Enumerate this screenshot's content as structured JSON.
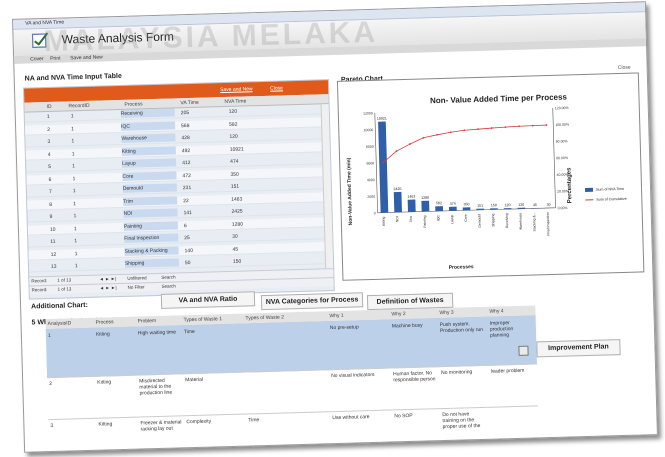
{
  "window": {
    "title": "VA and NVA Time"
  },
  "form": {
    "title": "Waste Analysis Form"
  },
  "ribbon": {
    "items": [
      "Cover",
      "Print",
      "Save and New"
    ]
  },
  "watermark": "MALAYSIA MELAKA",
  "nva": {
    "section_title": "NA and NVA Time Input Table",
    "save_new_label": "Save and New",
    "close_label": "Close",
    "columns": [
      "ID",
      "RecordID",
      "Process",
      "VA Time",
      "NVA Time"
    ],
    "rows": [
      {
        "id": "1",
        "rid": "1",
        "process": "Receiving",
        "va": "205",
        "nva": "120"
      },
      {
        "id": "2",
        "rid": "1",
        "process": "IQC",
        "va": "568",
        "nva": "582"
      },
      {
        "id": "3",
        "rid": "1",
        "process": "Warehouse",
        "va": "428",
        "nva": "120"
      },
      {
        "id": "4",
        "rid": "1",
        "process": "Kitting",
        "va": "492",
        "nva": "10921"
      },
      {
        "id": "5",
        "rid": "1",
        "process": "Layup",
        "va": "412",
        "nva": "474"
      },
      {
        "id": "6",
        "rid": "1",
        "process": "Core",
        "va": "472",
        "nva": "350"
      },
      {
        "id": "7",
        "rid": "1",
        "process": "Demould",
        "va": "231",
        "nva": "151"
      },
      {
        "id": "8",
        "rid": "1",
        "process": "Trim",
        "va": "22",
        "nva": "1463"
      },
      {
        "id": "9",
        "rid": "1",
        "process": "NDI",
        "va": "141",
        "nva": "2425"
      },
      {
        "id": "10",
        "rid": "1",
        "process": "Painting",
        "va": "6",
        "nva": "1280"
      },
      {
        "id": "11",
        "rid": "1",
        "process": "Final Inspection",
        "va": "25",
        "nva": "30"
      },
      {
        "id": "12",
        "rid": "1",
        "process": "Stacking & Packing",
        "va": "140",
        "nva": "45"
      },
      {
        "id": "13",
        "rid": "1",
        "process": "Shipping",
        "va": "50",
        "nva": "150"
      }
    ],
    "nav1": {
      "record_label": "Record:",
      "position": "1 of 13",
      "filter": "Unfiltered",
      "search": "Search"
    },
    "nav2": {
      "record_label": "Record:",
      "position": "1 of 13",
      "filter": "No Filter",
      "search": "Search"
    }
  },
  "pareto": {
    "section_title": "Pareto Chart",
    "close_label": "Close"
  },
  "chart_data": {
    "type": "bar",
    "title": "Non- Value Added Time per Process",
    "ylabel": "Non-Value Added Time (min)",
    "y2label": "Percentages",
    "xlabel": "Processes",
    "ylim": [
      0,
      12000
    ],
    "yticks": [
      "12000",
      "10000",
      "8000",
      "6000",
      "4000",
      "2000",
      "0"
    ],
    "y2ticks": [
      "120.00%",
      "100.00%",
      "80.00%",
      "60.00%",
      "40.00%",
      "20.00%",
      "0.00%"
    ],
    "categories": [
      "Kitting",
      "NDI",
      "Trim",
      "Painting",
      "IQC",
      "Layup",
      "Core",
      "Demould",
      "Shipping",
      "Receiving",
      "Warehouse",
      "Stacking &...",
      "Final Inspection"
    ],
    "series": [
      {
        "name": "Sum of NVA Time",
        "values": [
          10921,
          2425,
          1463,
          1280,
          582,
          474,
          350,
          151,
          150,
          120,
          120,
          45,
          30
        ]
      },
      {
        "name": "Sum of Cumulative",
        "values": [
          60.0,
          73.3,
          81.4,
          88.4,
          91.6,
          94.2,
          96.1,
          97.0,
          97.8,
          98.5,
          99.1,
          99.4,
          99.6
        ]
      }
    ],
    "data_labels": [
      "10921",
      "2425",
      "1463",
      "1280",
      "582",
      "474",
      "350",
      "151",
      "150",
      "120",
      "120",
      "45",
      "30"
    ],
    "legend_position": "right"
  },
  "additional": {
    "title": "Additional Chart:",
    "buttons": [
      "VA and NVA Ratio",
      "NVA Categories for Process",
      "Definition of Wastes"
    ]
  },
  "whys": {
    "title": "5 Whys Analysis Table",
    "columns": [
      "AnalysisID",
      "Process",
      "Problem",
      "Types of Waste 1",
      "Types of Waste 2",
      "Why 1",
      "Why 2",
      "Why 3",
      "Why 4"
    ],
    "rows": [
      {
        "id": "1",
        "process": "Kitting",
        "problem": "High waiting time",
        "waste1": "Time",
        "waste2": "",
        "why1": "No pre-setup",
        "why2": "Machine busy",
        "why3": "Push system. Production only run",
        "why4": "Improper production planning"
      },
      {
        "id": "2",
        "process": "Kitting",
        "problem": "Misdirected material to the production line",
        "waste1": "Material",
        "waste2": "",
        "why1": "No visual indicators",
        "why2": "Human factor. No responsible person",
        "why3": "No monitoring",
        "why4": "leader problem"
      },
      {
        "id": "3",
        "process": "Kitting",
        "problem": "Freezer & material racking lay out",
        "waste1": "Complexity",
        "waste2": "Time",
        "why1": "Use without care",
        "why2": "No SOP",
        "why3": "Do not have training on the proper use of the",
        "why4": ""
      }
    ],
    "improvement_button": "Improvement Plan"
  }
}
